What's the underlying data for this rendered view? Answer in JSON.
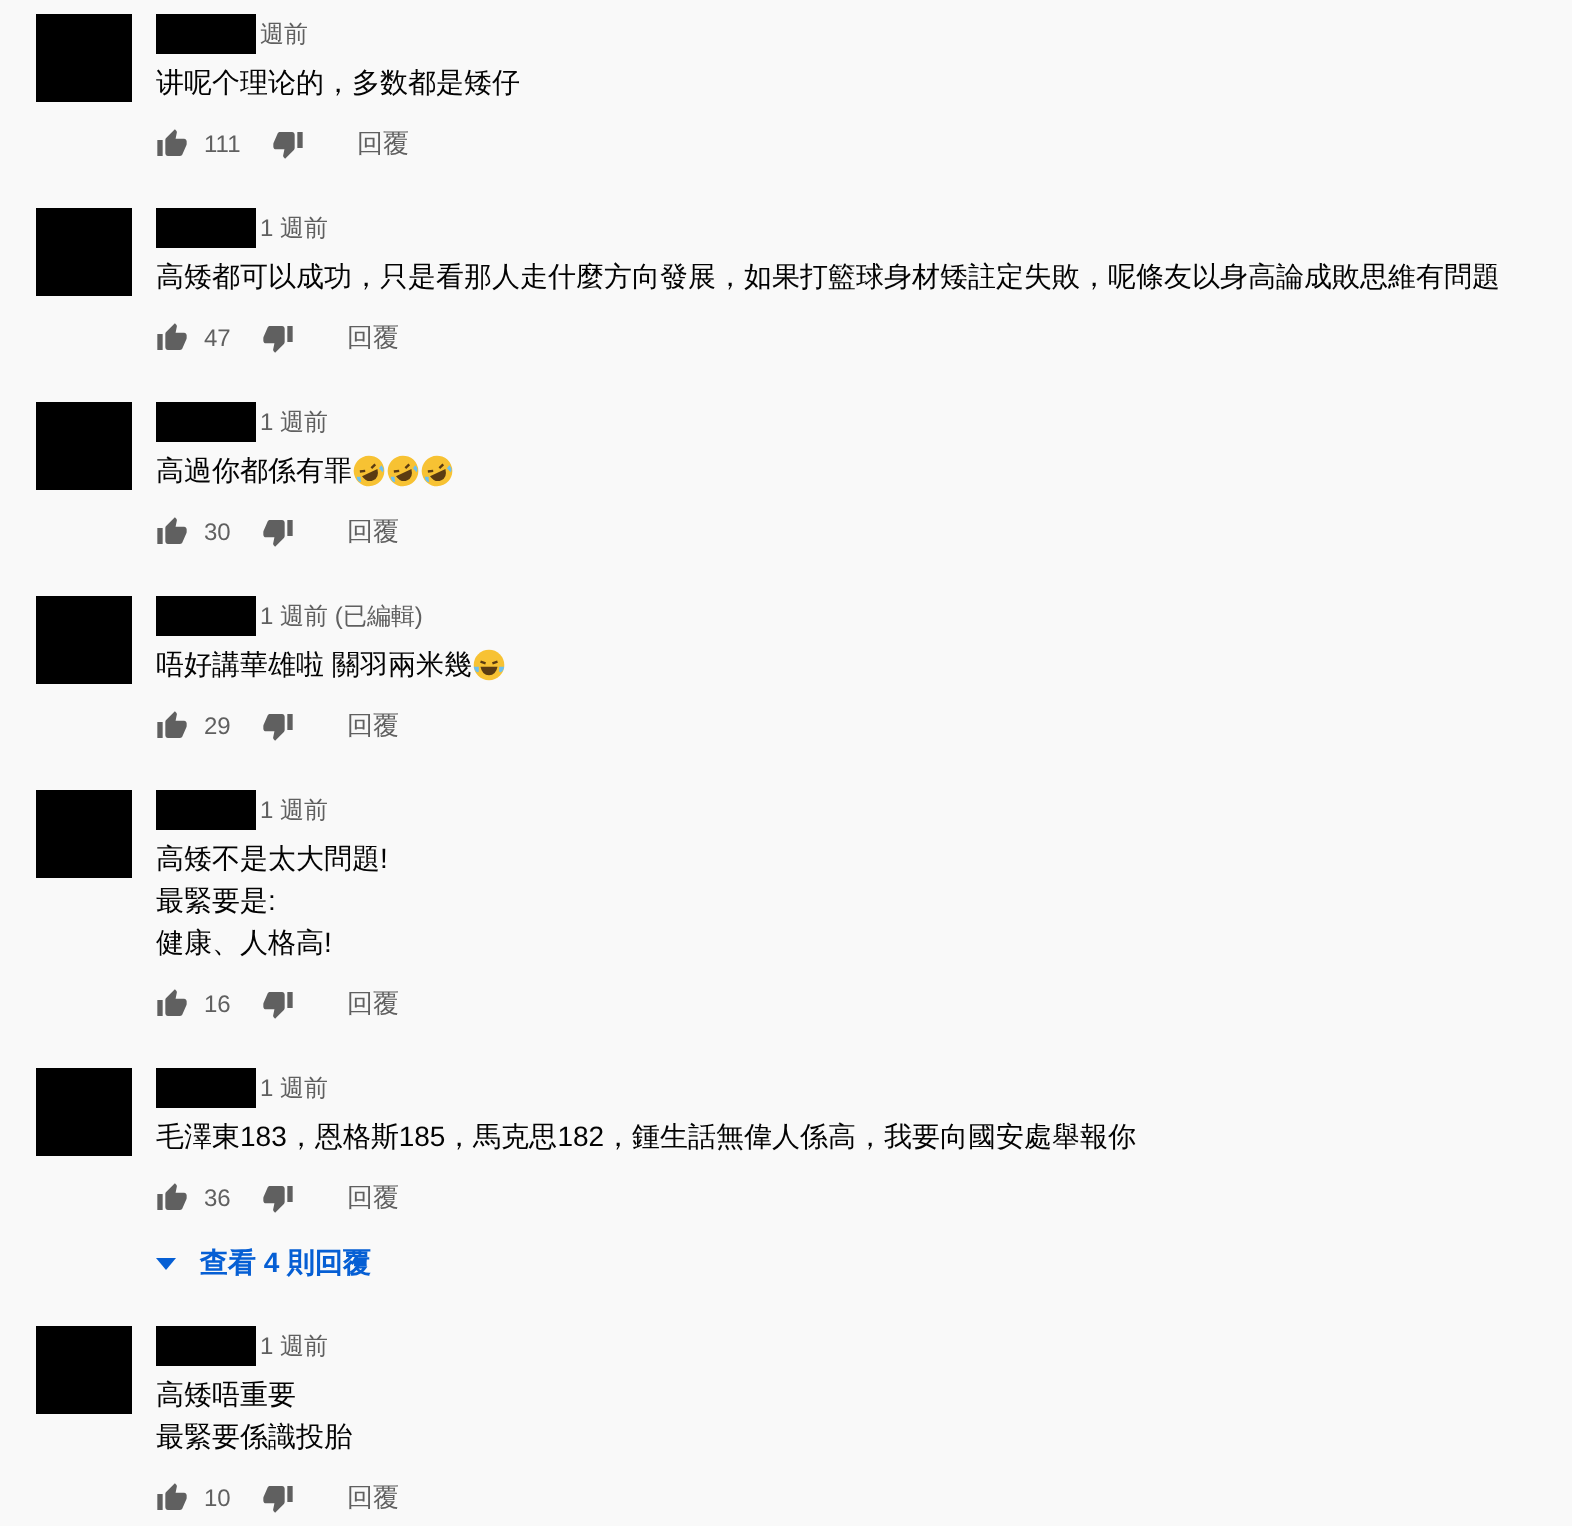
{
  "comments": [
    {
      "time": "週前",
      "lines": [
        "讲呢个理论的，多数都是矮仔"
      ],
      "likes": "111",
      "reply": "回覆"
    },
    {
      "time": "1 週前",
      "lines": [
        "高矮都可以成功，只是看那人走什麼方向發展，如果打籃球身材矮註定失敗，呢條友以身高論成敗思維有問題"
      ],
      "likes": "47",
      "reply": "回覆"
    },
    {
      "time": "1 週前",
      "lines": [
        "高過你都係有罪"
      ],
      "emojis": [
        {
          "kind": "rofl"
        },
        {
          "kind": "rofl"
        },
        {
          "kind": "rofl"
        }
      ],
      "likes": "30",
      "reply": "回覆"
    },
    {
      "time": "1 週前 (已編輯)",
      "lines": [
        "唔好講華雄啦 關羽兩米幾"
      ],
      "emojis": [
        {
          "kind": "tears-of-joy"
        }
      ],
      "likes": "29",
      "reply": "回覆"
    },
    {
      "time": "1 週前",
      "lines": [
        "高矮不是太大問題!",
        "最緊要是:",
        "健康、人格高!"
      ],
      "likes": "16",
      "reply": "回覆"
    },
    {
      "time": "1 週前",
      "lines": [
        "毛澤東183，恩格斯185，馬克思182，鍾生話無偉人係高，我要向國安處舉報你"
      ],
      "likes": "36",
      "reply": "回覆",
      "replies_link": "查看 4 則回覆"
    },
    {
      "time": "1 週前",
      "lines": [
        "高矮唔重要",
        "最緊要係識投胎"
      ],
      "likes": "10",
      "reply": "回覆"
    }
  ]
}
